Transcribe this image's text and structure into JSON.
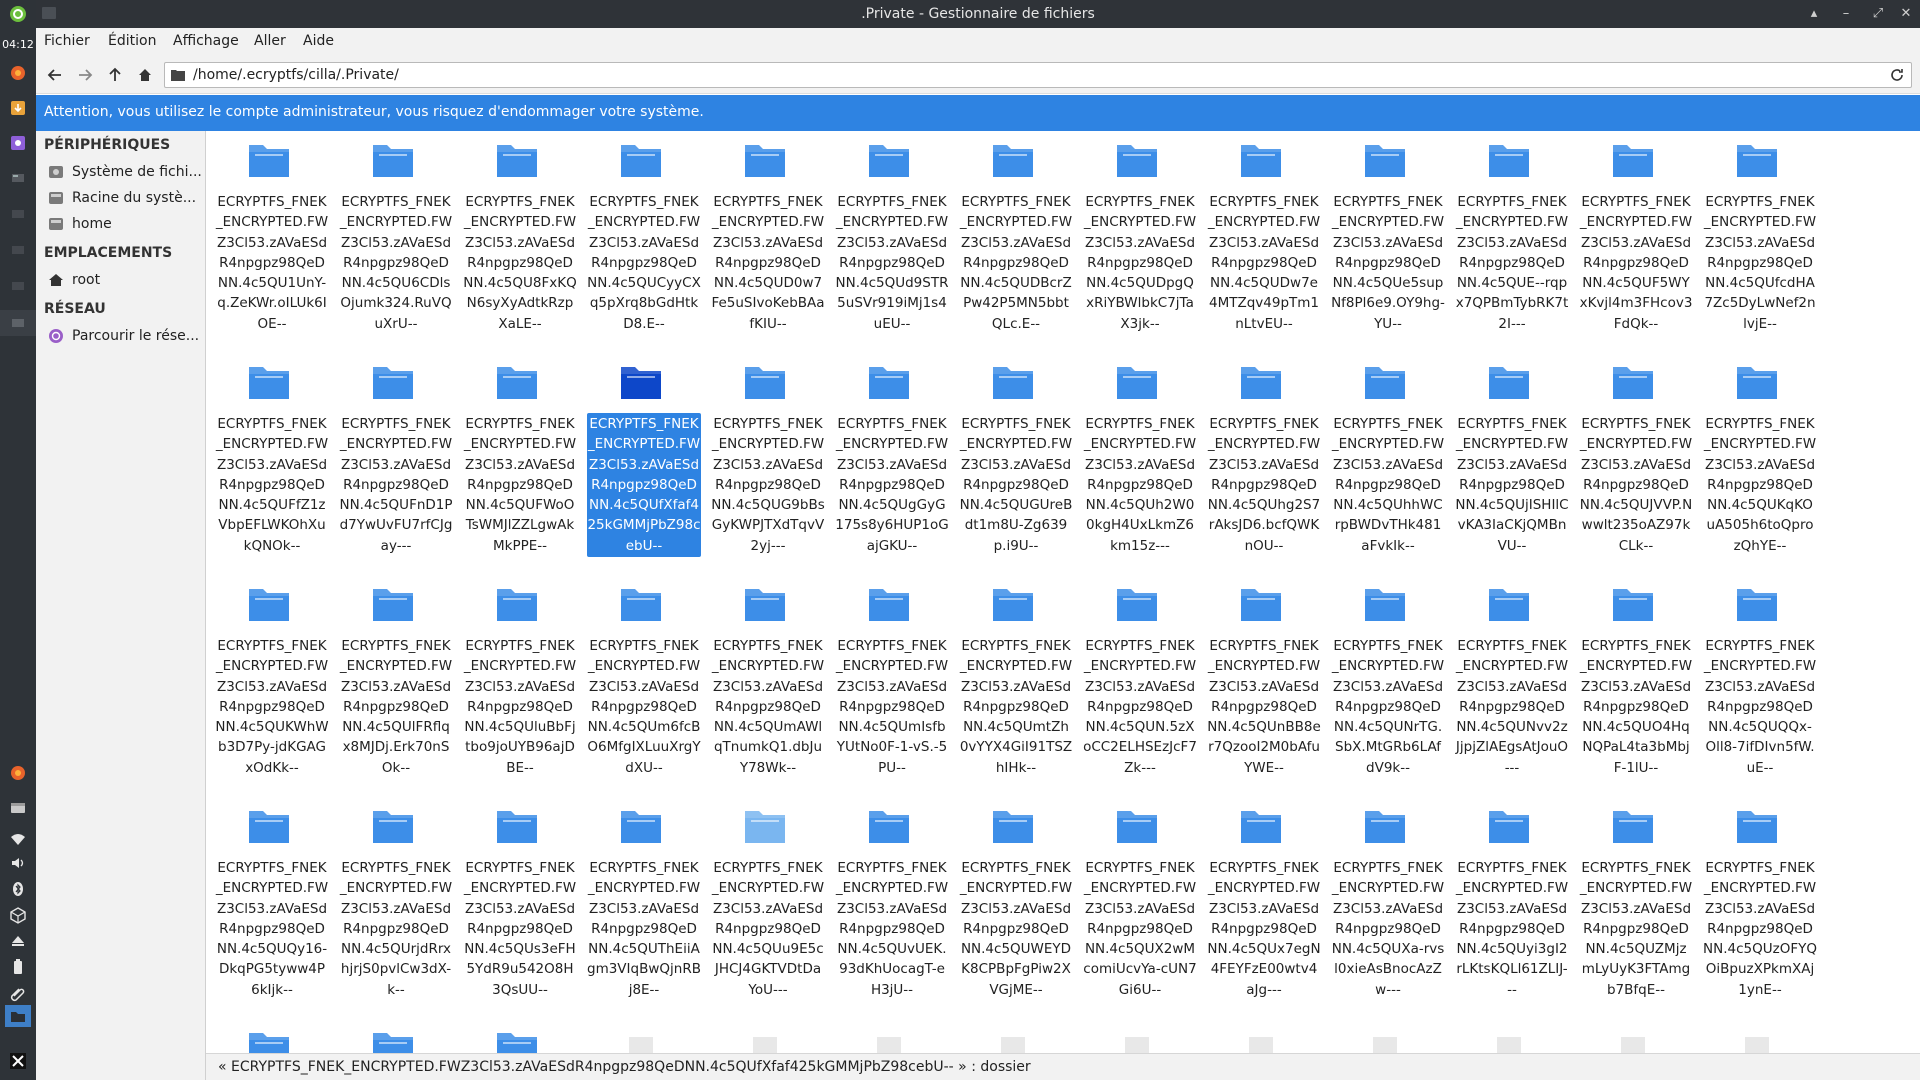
{
  "panel": {
    "clock": "04:12"
  },
  "window": {
    "title": ".Private - Gestionnaire de fichiers"
  },
  "menu": [
    "Fichier",
    "Édition",
    "Affichage",
    "Aller",
    "Aide"
  ],
  "address": {
    "path": "/home/.ecryptfs/cilla/.Private/"
  },
  "warning": "Attention, vous utilisez le compte administrateur, vous risquez d'endommager votre système.",
  "sidebar": {
    "sections": [
      {
        "title": "PÉRIPHÉRIQUES",
        "items": [
          {
            "label": "Système de fichi...",
            "icon": "drive-icon"
          },
          {
            "label": "Racine du systè...",
            "icon": "drive-icon"
          },
          {
            "label": "home",
            "icon": "drive-icon"
          }
        ]
      },
      {
        "title": "EMPLACEMENTS",
        "items": [
          {
            "label": "root",
            "icon": "home-icon"
          }
        ]
      },
      {
        "title": "RÉSEAU",
        "items": [
          {
            "label": "Parcourir le rése...",
            "icon": "network-icon"
          }
        ]
      }
    ]
  },
  "files": [
    "ECRYPTFS_FNEK_ENCRYPTED.FWZ3Cl53.zAVaESdR4npgpz98QeDNN.4c5QU1UnY-q.ZeKWr.oILUk6IOE--",
    "ECRYPTFS_FNEK_ENCRYPTED.FWZ3Cl53.zAVaESdR4npgpz98QeDNN.4c5QU6CDlsOjumk324.RuVQuXrU--",
    "ECRYPTFS_FNEK_ENCRYPTED.FWZ3Cl53.zAVaESdR4npgpz98QeDNN.4c5QU8FxKQN6syXyAdtkRzpXaLE--",
    "ECRYPTFS_FNEK_ENCRYPTED.FWZ3Cl53.zAVaESdR4npgpz98QeDNN.4c5QUCyyCXq5pXrq8bGdHtkD8.E--",
    "ECRYPTFS_FNEK_ENCRYPTED.FWZ3Cl53.zAVaESdR4npgpz98QeDNN.4c5QUD0w7Fe5uSIvoKebBAafKIU--",
    "ECRYPTFS_FNEK_ENCRYPTED.FWZ3Cl53.zAVaESdR4npgpz98QeDNN.4c5QUd9STR5uSVr919iMj1s4uEU--",
    "ECRYPTFS_FNEK_ENCRYPTED.FWZ3Cl53.zAVaESdR4npgpz98QeDNN.4c5QUDBcrZPw42P5MN5bbtQLc.E--",
    "ECRYPTFS_FNEK_ENCRYPTED.FWZ3Cl53.zAVaESdR4npgpz98QeDNN.4c5QUDpgQxRiYBWlbkC7jTaX3jk--",
    "ECRYPTFS_FNEK_ENCRYPTED.FWZ3Cl53.zAVaESdR4npgpz98QeDNN.4c5QUDw7e4MTZqv49pTm1nLtvEU--",
    "ECRYPTFS_FNEK_ENCRYPTED.FWZ3Cl53.zAVaESdR4npgpz98QeDNN.4c5QUe5supNf8Pl6e9.OY9hg-YU--",
    "ECRYPTFS_FNEK_ENCRYPTED.FWZ3Cl53.zAVaESdR4npgpz98QeDNN.4c5QUE--rqpx7QPBmTybRK7t2I---",
    "ECRYPTFS_FNEK_ENCRYPTED.FWZ3Cl53.zAVaESdR4npgpz98QeDNN.4c5QUF5WYxKvjl4m3FHcov3FdQk--",
    "ECRYPTFS_FNEK_ENCRYPTED.FWZ3Cl53.zAVaESdR4npgpz98QeDNN.4c5QUfcdHA7Zc5DyLwNef2nlvjE--",
    "ECRYPTFS_FNEK_ENCRYPTED.FWZ3Cl53.zAVaESdR4npgpz98QeDNN.4c5QUFfZ1zVbpEFLWKOhXukQNOk--",
    "ECRYPTFS_FNEK_ENCRYPTED.FWZ3Cl53.zAVaESdR4npgpz98QeDNN.4c5QUFnD1Pd7YwUvFU7rfCJgay---",
    "ECRYPTFS_FNEK_ENCRYPTED.FWZ3Cl53.zAVaESdR4npgpz98QeDNN.4c5QUFWoOTsWMJlZZLgwAkMkPPE--",
    "ECRYPTFS_FNEK_ENCRYPTED.FWZ3Cl53.zAVaESdR4npgpz98QeDNN.4c5QUfXfaf425kGMMjPbZ98cebU--",
    "ECRYPTFS_FNEK_ENCRYPTED.FWZ3Cl53.zAVaESdR4npgpz98QeDNN.4c5QUG9bBsGyKWPJTXdTqvV2yj---",
    "ECRYPTFS_FNEK_ENCRYPTED.FWZ3Cl53.zAVaESdR4npgpz98QeDNN.4c5QUgGyG175s8y6HUP1oGajGKU--",
    "ECRYPTFS_FNEK_ENCRYPTED.FWZ3Cl53.zAVaESdR4npgpz98QeDNN.4c5QUGUreBdt1m8U-Zg639p.i9U--",
    "ECRYPTFS_FNEK_ENCRYPTED.FWZ3Cl53.zAVaESdR4npgpz98QeDNN.4c5QUh2W00kgH4UxLkmZ6km15z---",
    "ECRYPTFS_FNEK_ENCRYPTED.FWZ3Cl53.zAVaESdR4npgpz98QeDNN.4c5QUhg2S7rAksJD6.bcfQWKnOU--",
    "ECRYPTFS_FNEK_ENCRYPTED.FWZ3Cl53.zAVaESdR4npgpz98QeDNN.4c5QUhhWCrpBWDvTHk481aFvkIk--",
    "ECRYPTFS_FNEK_ENCRYPTED.FWZ3Cl53.zAVaESdR4npgpz98QeDNN.4c5QUjISHIlCvKA3IaCKjQMBnVU--",
    "ECRYPTFS_FNEK_ENCRYPTED.FWZ3Cl53.zAVaESdR4npgpz98QeDNN.4c5QUJVVP.Nwwlt235oAZ97kCLk--",
    "ECRYPTFS_FNEK_ENCRYPTED.FWZ3Cl53.zAVaESdR4npgpz98QeDNN.4c5QUKqKOuA505h6toQprozQhYE--",
    "ECRYPTFS_FNEK_ENCRYPTED.FWZ3Cl53.zAVaESdR4npgpz98QeDNN.4c5QUKWhWb3D7Py-jdKGAGxOdKk--",
    "ECRYPTFS_FNEK_ENCRYPTED.FWZ3Cl53.zAVaESdR4npgpz98QeDNN.4c5QUlFRflqx8MJDj.Erk70nSOk--",
    "ECRYPTFS_FNEK_ENCRYPTED.FWZ3Cl53.zAVaESdR4npgpz98QeDNN.4c5QUluBbFjtbo9joUYB96ajDBE--",
    "ECRYPTFS_FNEK_ENCRYPTED.FWZ3Cl53.zAVaESdR4npgpz98QeDNN.4c5QUm6fcBO6MfgIXLuuXrgYdXU--",
    "ECRYPTFS_FNEK_ENCRYPTED.FWZ3Cl53.zAVaESdR4npgpz98QeDNN.4c5QUmAWlqTnumkQ1.dbJuY78Wk--",
    "ECRYPTFS_FNEK_ENCRYPTED.FWZ3Cl53.zAVaESdR4npgpz98QeDNN.4c5QUmIsfbYUtNo0F-1-vS.-5PU--",
    "ECRYPTFS_FNEK_ENCRYPTED.FWZ3Cl53.zAVaESdR4npgpz98QeDNN.4c5QUmtZh0vYYX4GiI91TSZhIHk--",
    "ECRYPTFS_FNEK_ENCRYPTED.FWZ3Cl53.zAVaESdR4npgpz98QeDNN.4c5QUN.5zXoCC2ELHSEzJcF7Zk---",
    "ECRYPTFS_FNEK_ENCRYPTED.FWZ3Cl53.zAVaESdR4npgpz98QeDNN.4c5QUnBB8er7QzooI2M0bAfuYWE--",
    "ECRYPTFS_FNEK_ENCRYPTED.FWZ3Cl53.zAVaESdR4npgpz98QeDNN.4c5QUNrTG.SbX.MtGRb6LAfdV9k--",
    "ECRYPTFS_FNEK_ENCRYPTED.FWZ3Cl53.zAVaESdR4npgpz98QeDNN.4c5QUNvv2zJjpjZlAEgsAtJouO---",
    "ECRYPTFS_FNEK_ENCRYPTED.FWZ3Cl53.zAVaESdR4npgpz98QeDNN.4c5QUO4HqNQPaL4ta3bMbjF-1lU--",
    "ECRYPTFS_FNEK_ENCRYPTED.FWZ3Cl53.zAVaESdR4npgpz98QeDNN.4c5QUQQx-Oll8-7ifDIvn5fW.uE--",
    "ECRYPTFS_FNEK_ENCRYPTED.FWZ3Cl53.zAVaESdR4npgpz98QeDNN.4c5QUQy16-DkqPG5tyww4P6kIjk--",
    "ECRYPTFS_FNEK_ENCRYPTED.FWZ3Cl53.zAVaESdR4npgpz98QeDNN.4c5QUrjdRrxhjrjS0pvlCw3dX-k--",
    "ECRYPTFS_FNEK_ENCRYPTED.FWZ3Cl53.zAVaESdR4npgpz98QeDNN.4c5QUs3eFH5YdR9u542O8H3QsUU--",
    "ECRYPTFS_FNEK_ENCRYPTED.FWZ3Cl53.zAVaESdR4npgpz98QeDNN.4c5QUThEiiAgm3VIqBwQjnRBj8E--",
    "ECRYPTFS_FNEK_ENCRYPTED.FWZ3Cl53.zAVaESdR4npgpz98QeDNN.4c5QUu9E5cJHCJ4GKTVDtDaYoU---",
    "ECRYPTFS_FNEK_ENCRYPTED.FWZ3Cl53.zAVaESdR4npgpz98QeDNN.4c5QUvUEK.93dKhUocagT-eH3jU--",
    "ECRYPTFS_FNEK_ENCRYPTED.FWZ3Cl53.zAVaESdR4npgpz98QeDNN.4c5QUWEYDK8CPBpFgPiw2XVGjME--",
    "ECRYPTFS_FNEK_ENCRYPTED.FWZ3Cl53.zAVaESdR4npgpz98QeDNN.4c5QUX2wMcomiUcvYa-cUN7Gi6U--",
    "ECRYPTFS_FNEK_ENCRYPTED.FWZ3Cl53.zAVaESdR4npgpz98QeDNN.4c5QUx7egN4FEYFzE00wtv4aJg---",
    "ECRYPTFS_FNEK_ENCRYPTED.FWZ3Cl53.zAVaESdR4npgpz98QeDNN.4c5QUXa-rvsl0xieAsBnocAzZw---",
    "ECRYPTFS_FNEK_ENCRYPTED.FWZ3Cl53.zAVaESdR4npgpz98QeDNN.4c5QUyi3gI2rLKtsKQLl61ZLIJ---",
    "ECRYPTFS_FNEK_ENCRYPTED.FWZ3Cl53.zAVaESdR4npgpz98QeDNN.4c5QUZMjzmLyUyK3FTAmgb7BfqE--",
    "ECRYPTFS_FNEK_ENCRYPTED.FWZ3Cl53.zAVaESdR4npgpz98QeDNN.4c5QUzOFYQOiBpuzXPkmXAj1ynE--"
  ],
  "selected_index": 16,
  "light_folder_index": 43,
  "status": "« ECRYPTFS_FNEK_ENCRYPTED.FWZ3Cl53.zAVaESdR4npgpz98QeDNN.4c5QUfXfaf425kGMMjPbZ98cebU-- » : dossier",
  "colors": {
    "accent": "#2e83e2",
    "folder": "#3d8ee8",
    "folder_selected": "#0d47c9",
    "folder_light": "#7ab6f0"
  }
}
